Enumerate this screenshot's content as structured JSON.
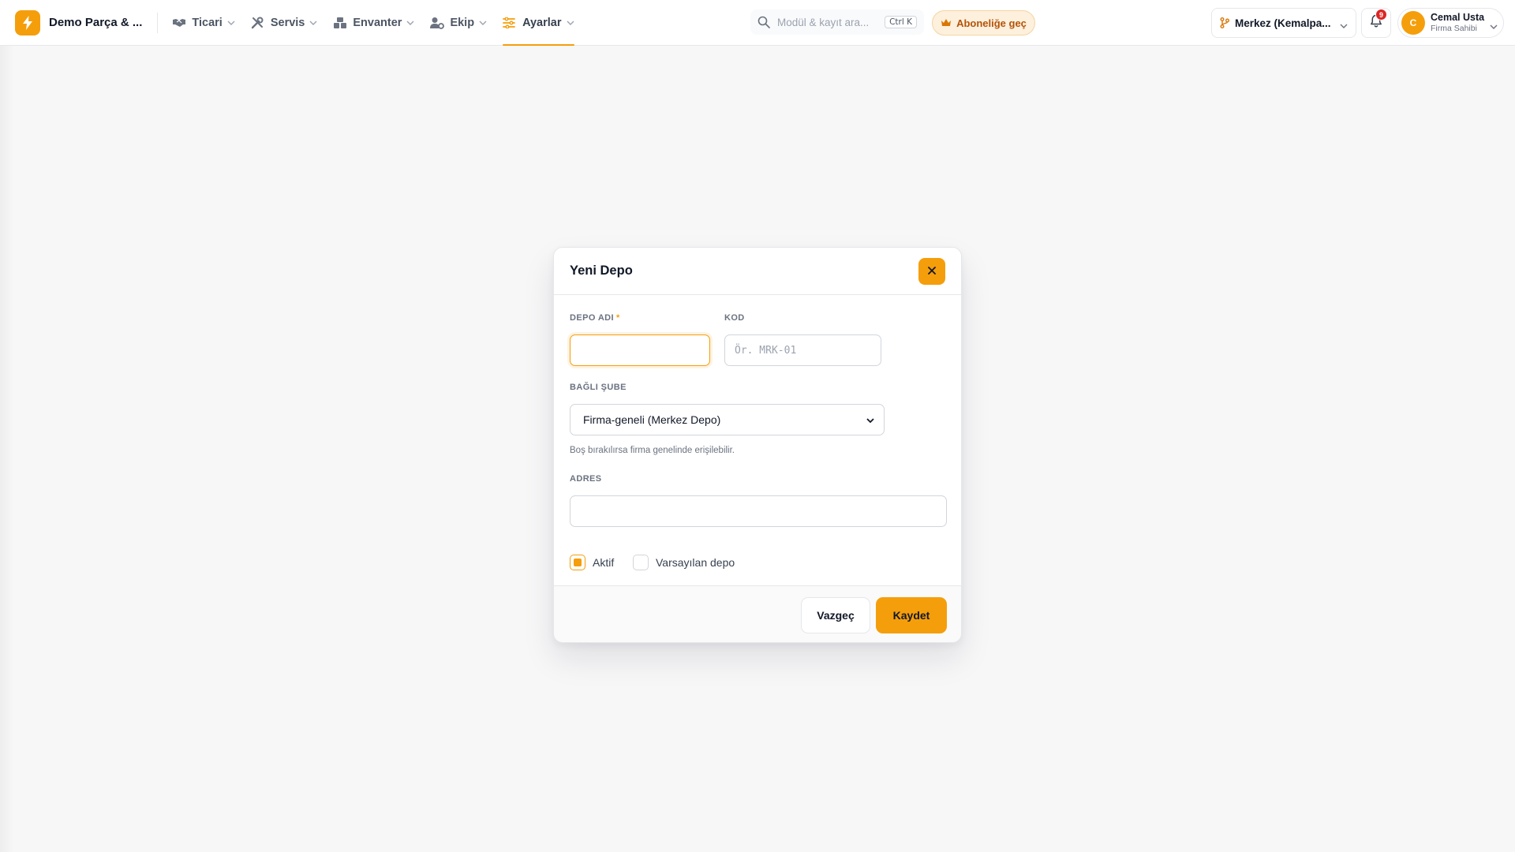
{
  "app": {
    "brand_name": "Demo Parça & ...",
    "colors": {
      "accent": "#f59e0b",
      "badge": "#dc2626"
    }
  },
  "nav": [
    {
      "label": "Ticari",
      "icon": "handshake-icon"
    },
    {
      "label": "Servis",
      "icon": "tools-icon"
    },
    {
      "label": "Envanter",
      "icon": "boxes-icon"
    },
    {
      "label": "Ekip",
      "icon": "users-gear-icon"
    },
    {
      "label": "Ayarlar",
      "icon": "sliders-icon",
      "active": true
    }
  ],
  "search": {
    "placeholder": "Modül & kayıt ara...",
    "shortcut": "Ctrl K"
  },
  "subscribe": {
    "label": "Aboneliğe geç"
  },
  "branch": {
    "label": "Merkez (Kemalpa..."
  },
  "notifications": {
    "count": "9"
  },
  "user": {
    "initial": "C",
    "name": "Cemal Usta",
    "role": "Firma Sahibi"
  },
  "modal": {
    "title": "Yeni Depo",
    "fields": {
      "name": {
        "label": "DEPO ADI",
        "required_mark": "*",
        "value": ""
      },
      "code": {
        "label": "KOD",
        "placeholder": "Ör. MRK-01"
      },
      "branch": {
        "label": "BAĞLI ŞUBE",
        "selected": "Firma-geneli (Merkez Depo)",
        "hint": "Boş bırakılırsa firma genelinde erişilebilir."
      },
      "address": {
        "label": "ADRES",
        "value": ""
      }
    },
    "checkboxes": [
      {
        "label": "Aktif",
        "checked": true
      },
      {
        "label": "Varsayılan depo",
        "checked": false
      }
    ],
    "buttons": {
      "cancel": "Vazgeç",
      "save": "Kaydet"
    }
  }
}
